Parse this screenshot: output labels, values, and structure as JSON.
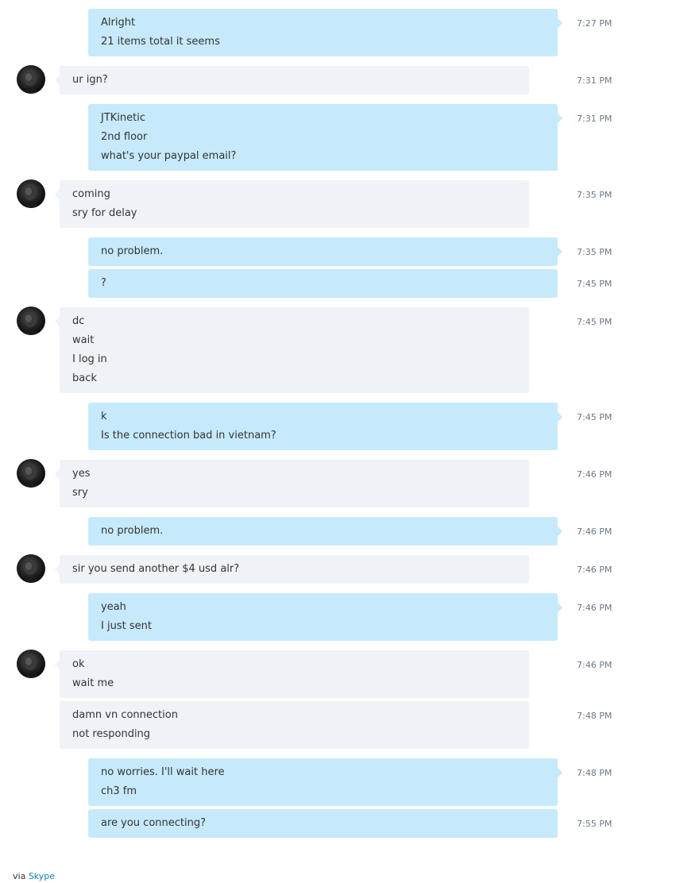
{
  "conversation": {
    "messages": [
      {
        "sender": "me",
        "lines": [
          "Alright",
          "21 items total it seems"
        ],
        "time": "7:27 PM"
      },
      {
        "sender": "them",
        "lines": [
          "ur ign?"
        ],
        "time": "7:31 PM"
      },
      {
        "sender": "me",
        "lines": [
          "JTKinetic",
          "2nd floor",
          "what's your paypal email?"
        ],
        "time": "7:31 PM"
      },
      {
        "sender": "them",
        "lines": [
          "coming",
          "sry for delay"
        ],
        "time": "7:35 PM"
      },
      {
        "sender": "me",
        "lines": [
          "no problem."
        ],
        "time": "7:35 PM"
      },
      {
        "sender": "me",
        "lines": [
          "?"
        ],
        "time": "7:45 PM"
      },
      {
        "sender": "them",
        "lines": [
          "dc",
          "wait",
          "I log in",
          "back"
        ],
        "time": "7:45 PM"
      },
      {
        "sender": "me",
        "lines": [
          "k",
          "Is the connection bad in vietnam?"
        ],
        "time": "7:45 PM"
      },
      {
        "sender": "them",
        "lines": [
          "yes",
          "sry"
        ],
        "time": "7:46 PM"
      },
      {
        "sender": "me",
        "lines": [
          "no problem."
        ],
        "time": "7:46 PM"
      },
      {
        "sender": "them",
        "lines": [
          "sir you send another $4 usd alr?"
        ],
        "time": "7:46 PM"
      },
      {
        "sender": "me",
        "lines": [
          "yeah",
          "I just sent"
        ],
        "time": "7:46 PM"
      },
      {
        "sender": "them",
        "lines": [
          "ok",
          "wait me"
        ],
        "time": "7:46 PM"
      },
      {
        "sender": "them",
        "lines": [
          "damn vn connection",
          "not responding"
        ],
        "time": "7:48 PM"
      },
      {
        "sender": "me",
        "lines": [
          "no worries. I'll wait here",
          "ch3 fm"
        ],
        "time": "7:48 PM"
      },
      {
        "sender": "me",
        "lines": [
          "are you connecting?"
        ],
        "time": "7:55 PM"
      }
    ]
  },
  "footer": {
    "prefix": "via",
    "link_label": "Skype"
  },
  "colors": {
    "outgoing_bubble": "#c6eafb",
    "incoming_bubble": "#eff2f6",
    "timestamp": "#6c7885",
    "link": "#0f7dbf"
  },
  "icons": {
    "avatar": "contact-avatar-icon"
  }
}
